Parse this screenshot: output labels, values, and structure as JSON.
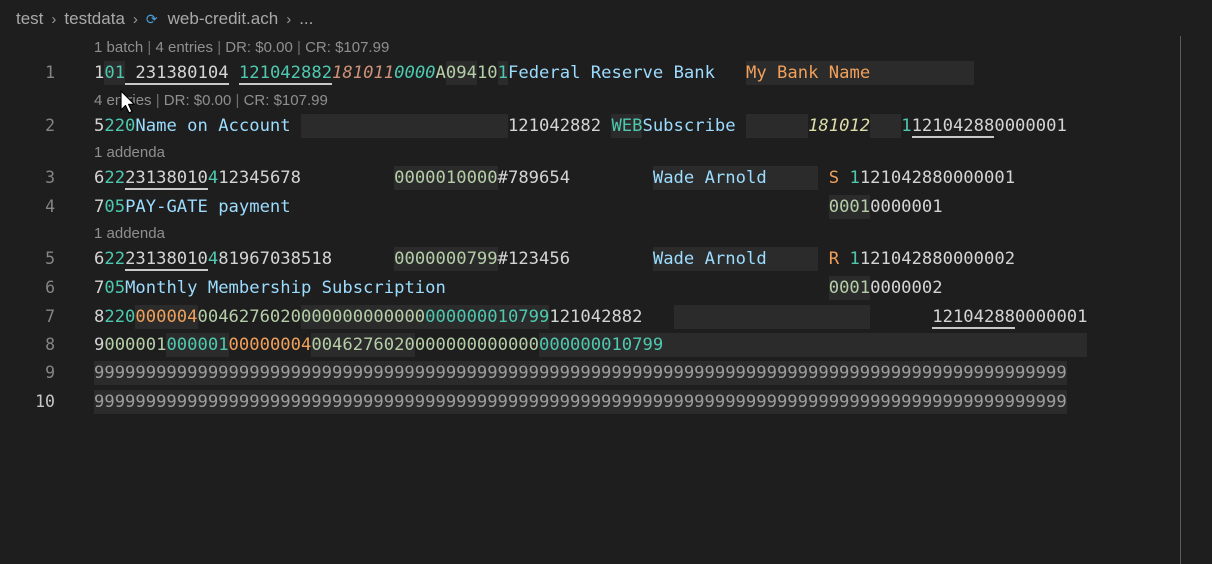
{
  "breadcrumb": {
    "items": [
      "test",
      "testdata",
      "web-credit.ach",
      "..."
    ],
    "separator": ">"
  },
  "codelens": {
    "file": [
      "1 batch",
      "4 entries",
      "DR: $0.00",
      "CR: $107.99"
    ],
    "batch": [
      "4 entries",
      "DR: $0.00",
      "CR: $107.99"
    ],
    "entry1": "1 addenda",
    "entry2": "1 addenda",
    "divider": "|"
  },
  "colors": {
    "background": "#1e1e1e",
    "white": "#d4d4d4",
    "teal": "#4ec9b0",
    "green": "#b5cea8",
    "blue": "#9cdcfe",
    "orange": "#ce9178",
    "orange_bright": "#f0a05a",
    "yellow": "#dcdcaa",
    "gray": "#9d9d9d"
  },
  "lines": [
    {
      "n": "1",
      "segs": [
        {
          "t": "1",
          "c": "white"
        },
        {
          "t": "01",
          "c": "teal",
          "h": 1
        },
        {
          "t": " 231380104",
          "c": "white",
          "u": 1
        },
        {
          "t": " ",
          "c": "white"
        },
        {
          "t": "121042882",
          "c": "teal",
          "u": 1
        },
        {
          "t": "181011",
          "c": "orange",
          "i": 1
        },
        {
          "t": "0000",
          "c": "teal",
          "i": 1
        },
        {
          "t": "A",
          "c": "green"
        },
        {
          "t": "094",
          "c": "green",
          "h": 1
        },
        {
          "t": "10",
          "c": "green"
        },
        {
          "t": "1",
          "c": "teal",
          "h": 1
        },
        {
          "t": "Federal Reserve Bank   ",
          "c": "blue"
        },
        {
          "t": "My Bank Name",
          "c": "orange_bright",
          "h": 1
        },
        {
          "t": "          ",
          "c": "white",
          "h": 1
        }
      ]
    },
    {
      "n": "2",
      "segs": [
        {
          "t": "5",
          "c": "white"
        },
        {
          "t": "220",
          "c": "teal"
        },
        {
          "t": "Name on Account ",
          "c": "blue"
        },
        {
          "t": "                    ",
          "c": "white",
          "h": 1
        },
        {
          "t": "121042882 ",
          "c": "white"
        },
        {
          "t": "WEB",
          "c": "teal",
          "h": 1
        },
        {
          "t": "Subscribe ",
          "c": "blue"
        },
        {
          "t": "      ",
          "c": "white",
          "h": 1
        },
        {
          "t": "181012",
          "c": "yellow",
          "i": 1
        },
        {
          "t": "   ",
          "c": "white",
          "h": 1
        },
        {
          "t": "1",
          "c": "teal"
        },
        {
          "t": "12104288",
          "c": "white",
          "u": 1
        },
        {
          "t": "0000001",
          "c": "white"
        }
      ]
    },
    {
      "n": "3",
      "segs": [
        {
          "t": "6",
          "c": "white"
        },
        {
          "t": "22",
          "c": "teal"
        },
        {
          "t": "23138010",
          "c": "white",
          "u": 1
        },
        {
          "t": "4",
          "c": "teal"
        },
        {
          "t": "12345678         ",
          "c": "white"
        },
        {
          "t": "0000010000",
          "c": "green",
          "h": 1
        },
        {
          "t": "#789654        ",
          "c": "white"
        },
        {
          "t": "Wade Arnold     ",
          "c": "blue",
          "h": 1
        },
        {
          "t": " S ",
          "c": "orange_bright"
        },
        {
          "t": "1",
          "c": "teal"
        },
        {
          "t": "121042880000001",
          "c": "white"
        }
      ]
    },
    {
      "n": "4",
      "segs": [
        {
          "t": "7",
          "c": "white"
        },
        {
          "t": "05",
          "c": "teal"
        },
        {
          "t": "PAY-GATE payment",
          "c": "blue"
        },
        {
          "t": "                                                    ",
          "c": "white"
        },
        {
          "t": "0001",
          "c": "green",
          "h": 1
        },
        {
          "t": "0000001",
          "c": "white"
        }
      ]
    },
    {
      "n": "5",
      "segs": [
        {
          "t": "6",
          "c": "white"
        },
        {
          "t": "22",
          "c": "teal"
        },
        {
          "t": "23138010",
          "c": "white",
          "u": 1
        },
        {
          "t": "4",
          "c": "teal"
        },
        {
          "t": "81967038518      ",
          "c": "white"
        },
        {
          "t": "0000000799",
          "c": "green",
          "h": 1
        },
        {
          "t": "#123456        ",
          "c": "white"
        },
        {
          "t": "Wade Arnold     ",
          "c": "blue",
          "h": 1
        },
        {
          "t": " R ",
          "c": "orange_bright"
        },
        {
          "t": "1",
          "c": "teal"
        },
        {
          "t": "121042880000002",
          "c": "white"
        }
      ]
    },
    {
      "n": "6",
      "segs": [
        {
          "t": "7",
          "c": "white"
        },
        {
          "t": "05",
          "c": "teal"
        },
        {
          "t": "Monthly Membership Subscription",
          "c": "blue"
        },
        {
          "t": "                                     ",
          "c": "white"
        },
        {
          "t": "0001",
          "c": "green",
          "h": 1
        },
        {
          "t": "0000002",
          "c": "white"
        }
      ]
    },
    {
      "n": "7",
      "segs": [
        {
          "t": "8",
          "c": "white"
        },
        {
          "t": "220",
          "c": "teal"
        },
        {
          "t": "000004",
          "c": "orange_bright",
          "h": 1
        },
        {
          "t": "0046276020",
          "c": "green"
        },
        {
          "t": "000000000000",
          "c": "green",
          "h": 1
        },
        {
          "t": "000000010799",
          "c": "teal",
          "h": 1
        },
        {
          "t": "121042882",
          "c": "white"
        },
        {
          "t": "   ",
          "c": "white"
        },
        {
          "t": "                   ",
          "c": "white",
          "h": 1
        },
        {
          "t": "      ",
          "c": "white"
        },
        {
          "t": "12104288",
          "c": "white",
          "u": 1
        },
        {
          "t": "0000001",
          "c": "white"
        }
      ]
    },
    {
      "n": "8",
      "segs": [
        {
          "t": "9",
          "c": "white"
        },
        {
          "t": "000001",
          "c": "green"
        },
        {
          "t": "000001",
          "c": "teal",
          "h": 1
        },
        {
          "t": "00000004",
          "c": "orange_bright"
        },
        {
          "t": "0046276020",
          "c": "green",
          "h": 1
        },
        {
          "t": "000000000000",
          "c": "green"
        },
        {
          "t": "000000010799",
          "c": "teal",
          "h": 1
        },
        {
          "t": "                                         ",
          "c": "white",
          "h": 1
        }
      ]
    },
    {
      "n": "9",
      "segs": [
        {
          "t": "9999999999999999999999999999999999999999999999999999999999999999999999999999999999999999999999",
          "c": "gray",
          "h": 1
        }
      ]
    },
    {
      "n": "10",
      "active": true,
      "segs": [
        {
          "t": "9999999999999999999999999999999999999999999999999999999999999999999999999999999999999999999999",
          "c": "gray",
          "h": 1
        }
      ]
    }
  ]
}
